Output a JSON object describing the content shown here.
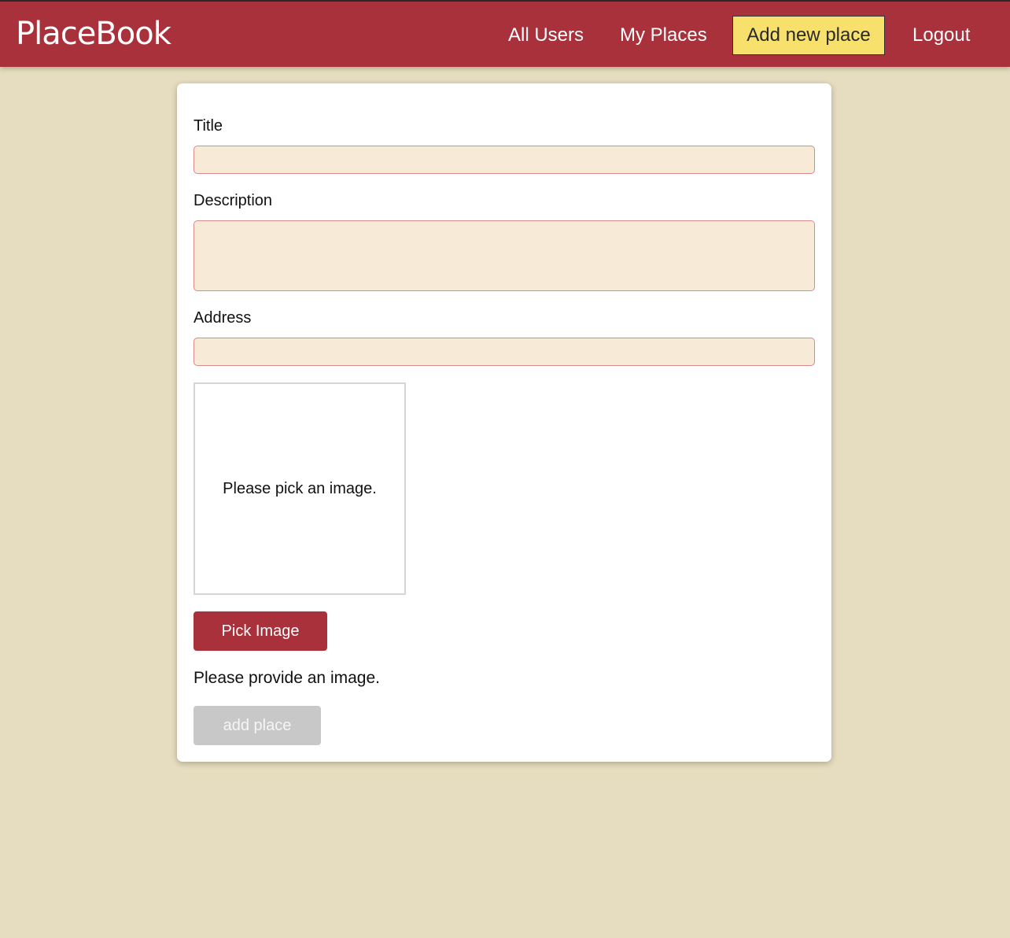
{
  "header": {
    "brand": "PlaceBook",
    "nav": {
      "all_users": "All Users",
      "my_places": "My Places",
      "add_new_place": "Add new place",
      "logout": "Logout"
    },
    "active_item": "Add new place"
  },
  "form": {
    "title_label": "Title",
    "title_value": "",
    "description_label": "Description",
    "description_value": "",
    "address_label": "Address",
    "address_value": "",
    "image_preview_text": "Please pick an image.",
    "pick_image_label": "Pick Image",
    "image_error_text": "Please provide an image.",
    "submit_label": "add place"
  },
  "colors": {
    "header_bg": "#a9313b",
    "page_bg": "#e6dcbf",
    "active_nav_bg": "#f7e06b",
    "input_bg": "#f7ead7",
    "input_border": "#d9888c",
    "primary_button": "#a9313b",
    "disabled_button": "#c8c8c8"
  }
}
